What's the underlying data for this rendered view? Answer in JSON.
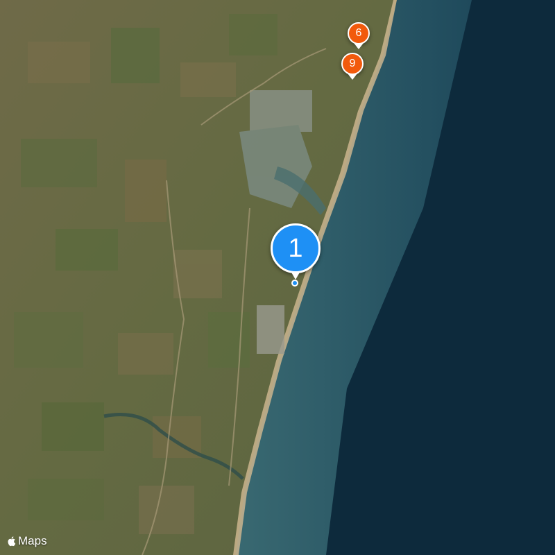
{
  "map": {
    "view": "satellite",
    "colors": {
      "deep_ocean": "#0d2a3c",
      "shallow_ocean": "#2c5a68",
      "land": "#6a6a44",
      "beach": "#cbb58e"
    }
  },
  "pins": [
    {
      "label": "1",
      "color": "#1e90f5",
      "kind": "selected"
    },
    {
      "label": "6",
      "color": "#f25a0c",
      "kind": "cluster"
    },
    {
      "label": "9",
      "color": "#f25a0c",
      "kind": "cluster"
    }
  ],
  "attribution": {
    "icon": "apple-logo-icon",
    "text": "Maps"
  }
}
